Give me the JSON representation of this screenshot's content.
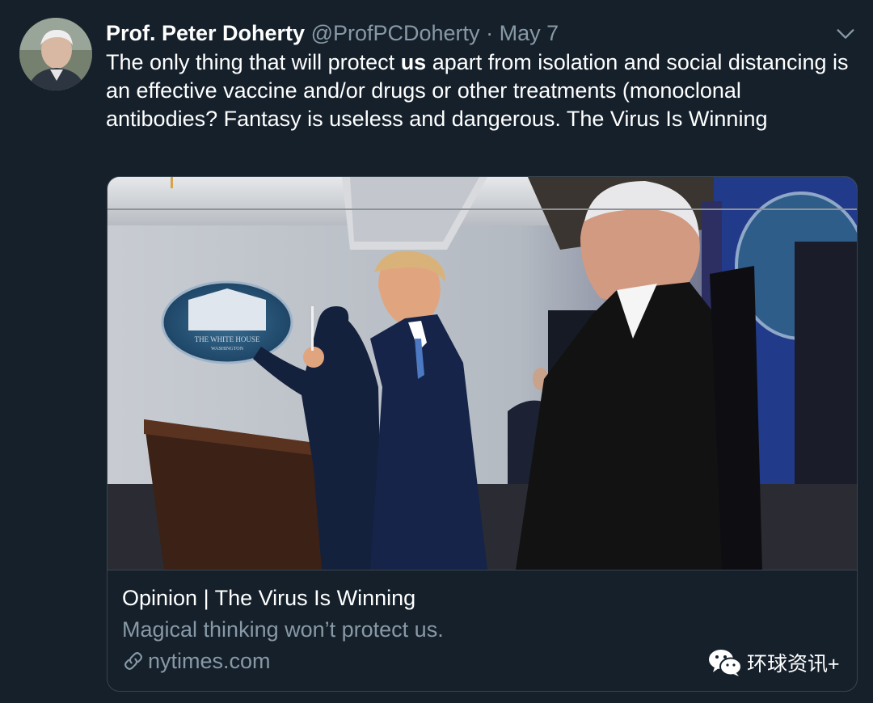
{
  "tweet": {
    "author_name": "Prof. Peter Doherty",
    "author_handle": "@ProfPCDoherty",
    "separator": "·",
    "date": "May 7",
    "text_before": "The only thing that will protect ",
    "text_bold": "us",
    "text_after": " apart from isolation and social distancing is an effective vaccine and/or drugs or other treatments (monoclonal antibodies? Fantasy is useless and dangerous. The Virus Is Winning"
  },
  "card": {
    "title": "Opinion | The Virus Is Winning",
    "description": "Magical thinking won’t protect us.",
    "domain": "nytimes.com",
    "image_seal_text": "THE WHITE HOUSE",
    "image_seal_subtext": "WASHINGTON"
  },
  "watermark": {
    "label": "环球资讯+"
  },
  "icons": {
    "more": "chevron-down-icon",
    "link": "link-icon",
    "watermark": "wechat-icon"
  },
  "colors": {
    "background": "#15202b",
    "secondary_text": "#8899a6",
    "border": "#38444d"
  }
}
